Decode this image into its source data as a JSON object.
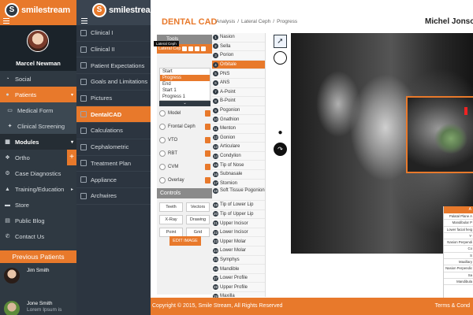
{
  "brand": {
    "name": "smilestream",
    "name2": "smilestrea"
  },
  "user": {
    "name": "Marcel Newman"
  },
  "nav1": [
    {
      "label": "Social",
      "icon": "speedometer-icon"
    },
    {
      "label": "Patients",
      "icon": "users-icon",
      "active": true
    },
    {
      "label": "Medical Form",
      "icon": "form-icon",
      "sub": true
    },
    {
      "label": "Clinical Screening",
      "icon": "screening-icon",
      "sub": true
    },
    {
      "label": "Modules",
      "icon": "modules-icon",
      "dark": true
    },
    {
      "label": "Ortho",
      "icon": "ortho-icon"
    },
    {
      "label": "Case Diagnostics",
      "icon": "diagnostics-icon"
    },
    {
      "label": "Training/Education",
      "icon": "training-icon"
    },
    {
      "label": "Store",
      "icon": "store-icon"
    },
    {
      "label": "Public Blog",
      "icon": "blog-icon"
    },
    {
      "label": "Contact Us",
      "icon": "phone-icon"
    }
  ],
  "previous_patients": {
    "heading": "Previous Patients",
    "items": [
      {
        "name": "Jim Smith",
        "desc": ""
      },
      {
        "name": "Jone Smith",
        "desc": "Lorem Ipsum is"
      }
    ]
  },
  "nav2": [
    {
      "label": "Clinical I"
    },
    {
      "label": "Clinical II"
    },
    {
      "label": "Patient Expectations"
    },
    {
      "label": "Goals and Limitations"
    },
    {
      "label": "Pictures"
    },
    {
      "label": "DentalCAD",
      "active": true
    },
    {
      "label": "Calculations"
    },
    {
      "label": "Cephalometric"
    },
    {
      "label": "Treatment Plan"
    },
    {
      "label": "Appliance"
    },
    {
      "label": "Archwires"
    }
  ],
  "header": {
    "title": "DENTAL CAD",
    "breadcrumb": [
      "Analysis",
      "/",
      "Lateral Ceph",
      "/",
      "Progress"
    ],
    "doctor": "Michel Jonson"
  },
  "panel": {
    "tools_label": "Tools",
    "lateral_ceph_label": "Lateral Cep",
    "tooltip": "Lateral Ceph",
    "progress_items": [
      "Start",
      "Progress",
      "End",
      "Start 1",
      "Progress 1"
    ],
    "progress_selected": 1,
    "rows": [
      "Model",
      "Frontal Ceph",
      "VTO",
      "RBT",
      "CVM",
      "Overlay"
    ],
    "controls_label": "Controls",
    "control_buttons": [
      "Teeth",
      "Vectors",
      "X-Ray",
      "Drawing",
      "Point",
      "Grid"
    ],
    "edit_button": "EDIT IMAGE"
  },
  "landmarks": [
    {
      "label": "Nasion",
      "n": "1"
    },
    {
      "label": "Sella",
      "n": "2"
    },
    {
      "label": "Porion",
      "n": "3"
    },
    {
      "label": "Orbitale",
      "n": "4",
      "selected": true
    },
    {
      "label": "PNS",
      "n": "5"
    },
    {
      "label": "ANS",
      "n": "6"
    },
    {
      "label": "A-Point",
      "n": "7"
    },
    {
      "label": "B-Point",
      "n": "8"
    },
    {
      "label": "Pogonion",
      "n": "9"
    },
    {
      "label": "Gnathion",
      "n": "10"
    },
    {
      "label": "Menton",
      "n": "11"
    },
    {
      "label": "Gonion",
      "n": "12"
    },
    {
      "label": "Articulare",
      "n": "13"
    },
    {
      "label": "Condylion",
      "n": "14"
    },
    {
      "label": "Tip of Nose",
      "n": "15"
    },
    {
      "label": "Subnasale",
      "n": "16"
    },
    {
      "label": "Stomion",
      "n": "17"
    },
    {
      "label": "Soft Tissue Pogonion",
      "n": "18",
      "tall": true
    },
    {
      "label": "Tip of Lower Lip",
      "n": "19"
    },
    {
      "label": "Tip of Upper Lip",
      "n": "20"
    },
    {
      "label": "Upper Incisor",
      "n": "21"
    },
    {
      "label": "Lower Incisor",
      "n": "22"
    },
    {
      "label": "Upper Molar",
      "n": "23"
    },
    {
      "label": "Lower Molar",
      "n": "24"
    },
    {
      "label": "Symphys",
      "n": "25"
    },
    {
      "label": "Mandible",
      "n": "26"
    },
    {
      "label": "Lower Profile",
      "n": "27"
    },
    {
      "label": "Upper Profile",
      "n": "28"
    },
    {
      "label": "Maxilla",
      "n": "29"
    }
  ],
  "measurements": {
    "header": "A",
    "rows": [
      "Palatal Plane A",
      "Mandibular P",
      "Lower facial heig",
      "Y-",
      "Nasion Perpendi",
      "Co",
      "S",
      "Maxillary",
      "Nasion Perpendic",
      "Sa",
      "Mandibula"
    ]
  },
  "footer": {
    "copyright": "Copyright © 2015, Smile Stream, All Rights Reserved",
    "terms": "Terms & Cond"
  },
  "colors": {
    "accent": "#e8792b",
    "sidebar": "#2f3942"
  }
}
